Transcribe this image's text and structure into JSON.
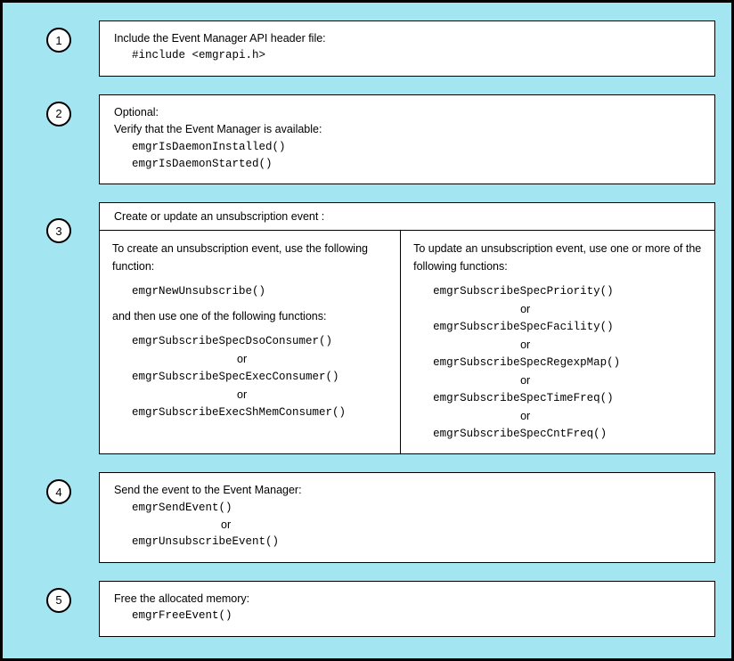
{
  "steps": [
    {
      "num": "1",
      "title": "Include the Event Manager API header file:",
      "code": [
        "#include <emgrapi.h>"
      ]
    },
    {
      "num": "2",
      "title_lines": [
        "Optional:",
        "Verify that the Event Manager is available:"
      ],
      "code": [
        "emgrIsDaemonInstalled()",
        "emgrIsDaemonStarted()"
      ]
    },
    {
      "num": "3",
      "header": "Create or update an unsubscription event :",
      "left": {
        "intro1": "To  create an unsubscription event, use the following function:",
        "fn1": "emgrNewUnsubscribe()",
        "intro2": "and  then use one of the following functions:",
        "fns": [
          "emgrSubscribeSpecDsoConsumer()",
          "emgrSubscribeSpecExecConsumer()",
          "emgrSubscribeExecShMemConsumer()"
        ],
        "or": "or"
      },
      "right": {
        "intro": "To  update an unsubscription event, use one or more of the following functions:",
        "fns": [
          "emgrSubscribeSpecPriority()",
          "emgrSubscribeSpecFacility()",
          "emgrSubscribeSpecRegexpMap()",
          "emgrSubscribeSpecTimeFreq()",
          "emgrSubscribeSpecCntFreq()"
        ],
        "or": "or"
      }
    },
    {
      "num": "4",
      "title": "Send the event to the Event Manager:",
      "code_or": {
        "a": "emgrSendEvent()",
        "or": "or",
        "b": "emgrUnsubscribeEvent()"
      }
    },
    {
      "num": "5",
      "title": "Free the allocated memory:",
      "code": [
        "emgrFreeEvent()"
      ]
    }
  ]
}
